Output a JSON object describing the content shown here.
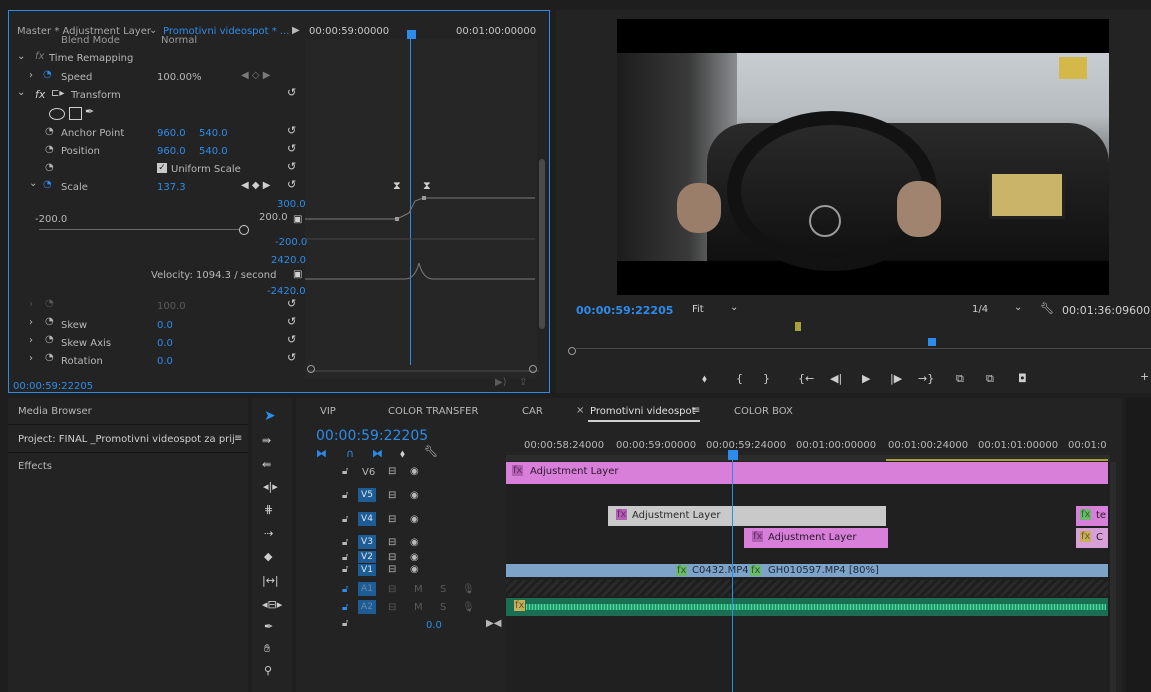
{
  "effect_controls": {
    "tab_master": "Master * Adjustment Layer",
    "tab_sequence": "Promotivni videospot * ...",
    "ruler_t1": "00:00:59:00000",
    "ruler_t2": "00:01:00:00000",
    "blend_mode_label": "Blend Mode",
    "blend_mode_value": "Normal",
    "time_remapping": "Time Remapping",
    "speed_label": "Speed",
    "speed_value": "100.00%",
    "transform_label": "Transform",
    "anchor_label": "Anchor Point",
    "anchor_x": "960.0",
    "anchor_y": "540.0",
    "position_label": "Position",
    "position_x": "960.0",
    "position_y": "540.0",
    "uniform_scale": "Uniform Scale",
    "scale_label": "Scale",
    "scale_value": "137.3",
    "graph_top": "300.0",
    "slider_min": "-200.0",
    "slider_max": "200.0",
    "graph_bottom": "-200.0",
    "vel_top": "2420.0",
    "velocity": "Velocity: 1094.3 / second",
    "vel_bottom": "-2420.0",
    "scale_width_value": "100.0",
    "skew_label": "Skew",
    "skew_value": "0.0",
    "skew_axis_label": "Skew Axis",
    "skew_axis_value": "0.0",
    "rotation_label": "Rotation",
    "rotation_value": "0.0",
    "timecode": "00:00:59:22205"
  },
  "program": {
    "timecode": "00:00:59:22205",
    "fit": "Fit",
    "resolution": "1/4",
    "duration": "00:01:36:09600"
  },
  "project_panel": {
    "media_browser": "Media Browser",
    "project": "Project: FINAL _Promotivni videospot za prij",
    "effects": "Effects"
  },
  "timeline": {
    "tabs": [
      "VIP",
      "COLOR TRANSFER",
      "CAR",
      "Promotivni videospot",
      "COLOR BOX"
    ],
    "timecode": "00:00:59:22205",
    "ruler": [
      "00:00:58:24000",
      "00:00:59:00000",
      "00:00:59:24000",
      "00:01:00:00000",
      "00:01:00:24000",
      "00:01:01:00000",
      "00:01:0"
    ],
    "tracks": [
      "V6",
      "V5",
      "V4",
      "V3",
      "V2",
      "V1",
      "A1",
      "A2"
    ],
    "audio_level": "0.0",
    "clip_adj1": "Adjustment Layer",
    "clip_adj2": "Adjustment Layer",
    "clip_adj3": "Adjustment Layer",
    "clip_te": "te",
    "clip_c": "C",
    "clip_v1a": "C0432.MP4",
    "clip_v1b": "GH010597.MP4 [80%]"
  }
}
